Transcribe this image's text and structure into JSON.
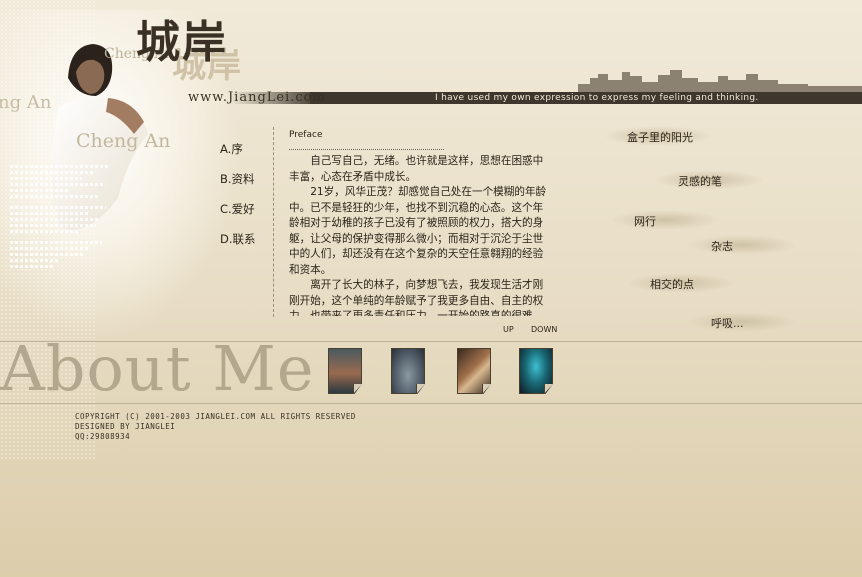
{
  "header": {
    "title_cn": "城岸",
    "title_cn_shadow": "城岸",
    "site_url": "www.JiangLei.com",
    "tagline": "I have used my own expression to express my feeling and thinking.",
    "deco_names": [
      "Cheng An",
      "ng An",
      "Cheng An"
    ]
  },
  "nav": {
    "items": [
      {
        "label": "A.序"
      },
      {
        "label": "B.资料"
      },
      {
        "label": "C.爱好"
      },
      {
        "label": "D.联系"
      }
    ]
  },
  "content": {
    "heading": "Preface",
    "paragraphs": [
      "自己写自己，无绪。也许就是这样，思想在困惑中丰富，心态在矛盾中成长。",
      "21岁，风华正茂？却感觉自己处在一个模糊的年龄中。已不是轻狂的少年，也找不到沉稳的心态。这个年龄相对于幼稚的孩子已没有了被照顾的权力，搭大的身躯，让父母的保护变得那么微小；而相对于沉沦于尘世中的人们，却还没有在这个复杂的天空任意翱翔的经验和资本。",
      "离开了长大的林子，向梦想飞去，我发现生活才刚刚开始，这个单纯的年龄赋予了我更多自由、自主的权力，也带来了更多责任和压力。一开始的路真的很难走，热情总是在现实中冷却，心底在风雨中沉淀。"
    ],
    "up_label": "UP",
    "down_label": "DOWN"
  },
  "right_links": [
    {
      "label": "盒子里的阳光"
    },
    {
      "label": "灵感的笔"
    },
    {
      "label": "网行"
    },
    {
      "label": "杂志"
    },
    {
      "label": "相交的点"
    },
    {
      "label": "呼吸..."
    }
  ],
  "bottom": {
    "about_me": "About Me",
    "thumbnails": [
      {
        "icon": "sunset-photo"
      },
      {
        "icon": "eye-photo"
      },
      {
        "icon": "guitar-photo"
      },
      {
        "icon": "screen-photo"
      }
    ]
  },
  "footer": {
    "line1": "COPYRIGHT (C) 2001-2003 JIANGLEI.COM ALL RIGHTS RESERVED",
    "line2": "DESIGNED BY JIANGLEI",
    "line3": "QQ:29808934"
  },
  "colors": {
    "background": "#e9dfc8",
    "header_bar": "#3d372d",
    "text": "#2b2418",
    "about_me": "#b3a88e"
  }
}
